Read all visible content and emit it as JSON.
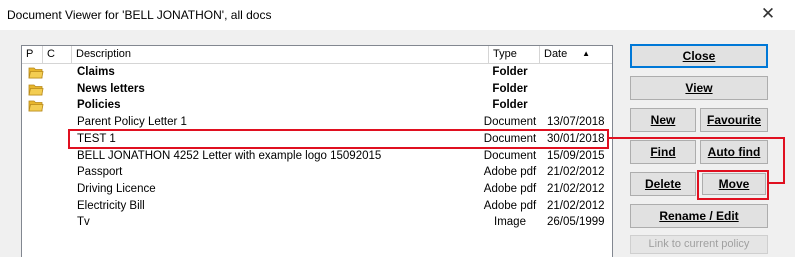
{
  "window": {
    "title": "Document Viewer for 'BELL JONATHON', all docs",
    "close_glyph": "✕"
  },
  "columns": {
    "p": "P",
    "c": "C",
    "description": "Description",
    "type": "Type",
    "date": "Date",
    "sort_glyph": "▲"
  },
  "rows": [
    {
      "description": "Claims",
      "type": "Folder",
      "date": "",
      "is_folder": true
    },
    {
      "description": "News letters",
      "type": "Folder",
      "date": "",
      "is_folder": true
    },
    {
      "description": "Policies",
      "type": "Folder",
      "date": "",
      "is_folder": true
    },
    {
      "description": "Parent Policy Letter 1",
      "type": "Document",
      "date": "13/07/2018",
      "is_folder": false
    },
    {
      "description": "TEST 1",
      "type": "Document",
      "date": "30/01/2018",
      "is_folder": false
    },
    {
      "description": "BELL JONATHON 4252 Letter  with example logo 15092015",
      "type": "Document",
      "date": "15/09/2015",
      "is_folder": false
    },
    {
      "description": "Passport",
      "type": "Adobe pdf",
      "date": "21/02/2012",
      "is_folder": false
    },
    {
      "description": "Driving Licence",
      "type": "Adobe pdf",
      "date": "21/02/2012",
      "is_folder": false
    },
    {
      "description": "Electricity Bill",
      "type": "Adobe pdf",
      "date": "21/02/2012",
      "is_folder": false
    },
    {
      "description": "Tv",
      "type": "Image",
      "date": "26/05/1999",
      "is_folder": false
    }
  ],
  "buttons": {
    "close": "Close",
    "view": "View",
    "new": "New",
    "favourite": "Favourite",
    "find": "Find",
    "auto_find": "Auto find",
    "delete": "Delete",
    "move": "Move",
    "rename_edit": "Rename / Edit",
    "link_policy": "Link to current policy"
  },
  "colors": {
    "annotation": "#e01020",
    "folder": "#e8b62c"
  }
}
